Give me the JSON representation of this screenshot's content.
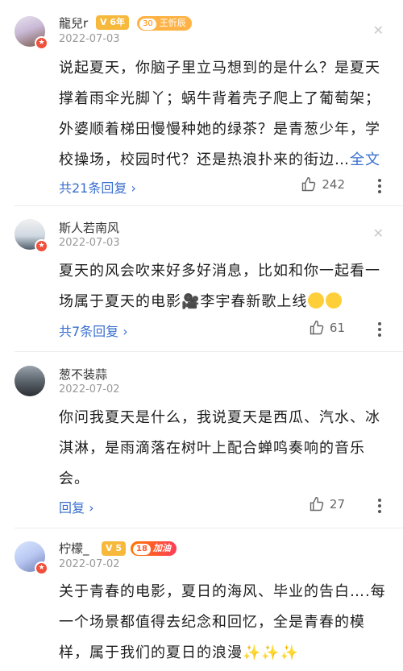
{
  "comments": [
    {
      "username": "龍兒r",
      "date": "2022-07-03",
      "level_badge": "6年",
      "fan_badge_level": "30",
      "fan_badge_text": "王忻辰",
      "text": "说起夏天，你脑子里立马想到的是什么？是夏天撑着雨伞光脚丫；蜗牛背着壳子爬上了葡萄架；外婆顺着梯田慢慢种她的绿茶？是青葱少年，学校操场，校园时代？还是热浪扑来的街边…",
      "more_label": "全文",
      "reply_label": "共21条回复",
      "likes": "242"
    },
    {
      "username": "斯人若南风",
      "date": "2022-07-03",
      "text": "夏天的风会吹来好多好消息，比如和你一起看一场属于夏天的电影🎥李宇春新歌上线",
      "reply_label": "共7条回复",
      "likes": "61"
    },
    {
      "username": "葱不装蒜",
      "date": "2022-07-02",
      "text": "你问我夏天是什么，我说夏天是西瓜、汽水、冰淇淋，是雨滴落在树叶上配合蝉鸣奏响的音乐会。",
      "reply_label": "回复",
      "likes": "27"
    },
    {
      "username": "柠檬_",
      "date": "2022-07-02",
      "level_badge": "5",
      "fan_badge_level": "18",
      "fan_badge_text": "加油",
      "text": "关于青春的电影，夏日的海风、毕业的告白….每一个场景都值得去纪念和回忆，全是青春的模样，属于我们的夏日的浪漫"
    }
  ],
  "icons": {
    "close": "close-icon",
    "like": "thumb-up-icon",
    "more": "more-vertical-icon",
    "chevron": "chevron-right-icon"
  },
  "colors": {
    "link": "#3a6fcf",
    "vip": "#f04f3a",
    "level_badge": "#f6b93b"
  }
}
